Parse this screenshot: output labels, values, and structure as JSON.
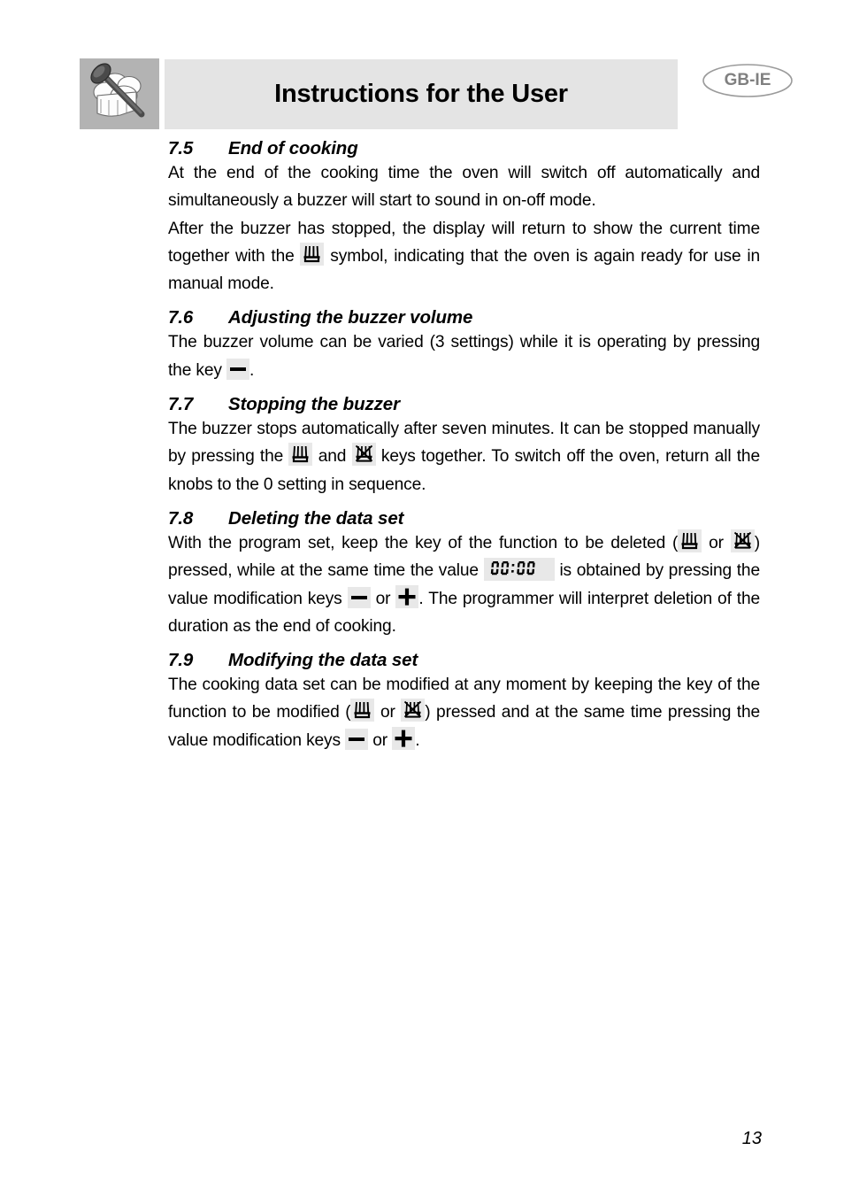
{
  "header": {
    "title": "Instructions for the User",
    "language_badge": "GB-IE",
    "icon_name": "chef-hat-and-spoon-icon"
  },
  "icons": {
    "pot": "cooking-duration-pot-icon",
    "pot_crossed": "end-of-cooking-pot-crossed-icon",
    "minus": "minus-key-icon",
    "plus": "plus-key-icon",
    "lcd_value": "00:00"
  },
  "sections": [
    {
      "number": "7.5",
      "title": "End of cooking",
      "paragraphs": [
        {
          "id": "p1",
          "runs": [
            {
              "type": "text",
              "value": "At the end of the cooking time the oven will switch off automatically and simultaneously a buzzer will start to sound in on-off mode."
            }
          ]
        },
        {
          "id": "p2",
          "runs": [
            {
              "type": "text",
              "value": "After the buzzer has stopped, the display will return to show the current time together with the "
            },
            {
              "type": "icon",
              "value": "pot"
            },
            {
              "type": "text",
              "value": " symbol, indicating that the oven is again ready for use in manual mode."
            }
          ]
        }
      ]
    },
    {
      "number": "7.6",
      "title": "Adjusting the buzzer volume",
      "paragraphs": [
        {
          "id": "p3",
          "runs": [
            {
              "type": "text",
              "value": "The buzzer volume can be varied (3 settings) while it is operating by pressing the key "
            },
            {
              "type": "icon",
              "value": "minus"
            },
            {
              "type": "text",
              "value": "."
            }
          ]
        }
      ]
    },
    {
      "number": "7.7",
      "title": "Stopping the buzzer",
      "paragraphs": [
        {
          "id": "p4",
          "runs": [
            {
              "type": "text",
              "value": "The buzzer stops automatically after seven minutes. It can be stopped manually by pressing the "
            },
            {
              "type": "icon",
              "value": "pot"
            },
            {
              "type": "text",
              "value": " and "
            },
            {
              "type": "icon",
              "value": "pot_crossed"
            },
            {
              "type": "text",
              "value": " keys together. To switch off the oven, return all the knobs to the 0 setting in sequence."
            }
          ]
        }
      ]
    },
    {
      "number": "7.8",
      "title": "Deleting the data set",
      "paragraphs": [
        {
          "id": "p5",
          "runs": [
            {
              "type": "text",
              "value": "With the program set, keep the key of the function to be deleted ("
            },
            {
              "type": "icon",
              "value": "pot"
            },
            {
              "type": "text",
              "value": " or "
            },
            {
              "type": "icon",
              "value": "pot_crossed"
            },
            {
              "type": "text",
              "value": ") pressed, while at the same time the value "
            },
            {
              "type": "icon",
              "value": "lcd"
            },
            {
              "type": "text",
              "value": " is obtained by pressing the value modification keys "
            },
            {
              "type": "icon",
              "value": "minus"
            },
            {
              "type": "text",
              "value": " or "
            },
            {
              "type": "icon",
              "value": "plus"
            },
            {
              "type": "text",
              "value": ". The programmer will interpret deletion of the duration as the end of cooking."
            }
          ]
        }
      ]
    },
    {
      "number": "7.9",
      "title": "Modifying the data set",
      "paragraphs": [
        {
          "id": "p6",
          "runs": [
            {
              "type": "text",
              "value": "The cooking data set can be modified at any moment by keeping the key of the function to be modified ("
            },
            {
              "type": "icon",
              "value": "pot"
            },
            {
              "type": "text",
              "value": " or "
            },
            {
              "type": "icon",
              "value": "pot_crossed"
            },
            {
              "type": "text",
              "value": ") pressed and at the same time pressing the value modification keys "
            },
            {
              "type": "icon",
              "value": "minus"
            },
            {
              "type": "text",
              "value": " or "
            },
            {
              "type": "icon",
              "value": "plus"
            },
            {
              "type": "text",
              "value": "."
            }
          ]
        }
      ]
    }
  ],
  "footer": {
    "page_number": "13"
  },
  "colors": {
    "header_band": "#e4e4e4",
    "icon_panel": "#b3b3b3",
    "key_background": "#e8e8e8",
    "badge_text": "#808080",
    "text": "#000000"
  }
}
